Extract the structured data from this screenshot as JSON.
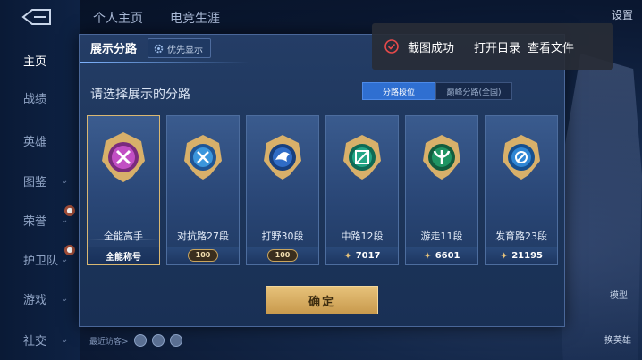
{
  "nav": {
    "items": [
      {
        "label": "主页",
        "active": true
      },
      {
        "label": "战绩"
      },
      {
        "label": "英雄"
      },
      {
        "label": "图鉴",
        "chevron": true
      },
      {
        "label": "荣誉",
        "chevron": true
      },
      {
        "label": "护卫队",
        "chevron": true
      },
      {
        "label": "游戏",
        "chevron": true
      },
      {
        "label": "社交",
        "chevron": true
      }
    ]
  },
  "top_tabs": [
    "个人主页",
    "电竞生涯"
  ],
  "top_right": "设置",
  "modal": {
    "title": "展示分路",
    "pref_button": "优先显示",
    "prompt": "请选择展示的分路",
    "segments": [
      "分路段位",
      "巅峰分路(全国)"
    ],
    "cards": [
      {
        "name": "全能高手",
        "sub": "全能称号",
        "emblem": "all-rounder",
        "color": "#b63fb8",
        "selected": true
      },
      {
        "name": "对抗路27段",
        "sub": "100",
        "emblem": "clash-lane",
        "color": "#3a8fd6",
        "badge": true
      },
      {
        "name": "打野30段",
        "sub": "100",
        "emblem": "jungle",
        "color": "#2c6bc4",
        "badge": true
      },
      {
        "name": "中路12段",
        "sub": "7017",
        "emblem": "mid-lane",
        "color": "#1f9a7a"
      },
      {
        "name": "游走11段",
        "sub": "6601",
        "emblem": "roam",
        "color": "#1f8a5e"
      },
      {
        "name": "发育路23段",
        "sub": "21195",
        "emblem": "farm-lane",
        "color": "#2a7fd0"
      }
    ],
    "confirm": "确定",
    "visitors_label": "最近访客>"
  },
  "toast": {
    "status": "截图成功",
    "open_dir": "打开目录",
    "view_file": "查看文件"
  },
  "right_buttons": [
    "模型",
    "换英雄"
  ],
  "colors": {
    "accent": "#2f6fd1",
    "gold": "#e7c27a",
    "modal_bg": "#213a62"
  }
}
